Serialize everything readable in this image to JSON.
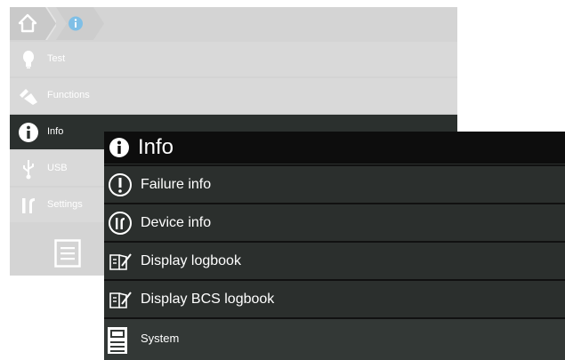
{
  "background_menu": {
    "items": [
      {
        "label": "Test",
        "icon": "lightbulb-icon"
      },
      {
        "label": "Functions",
        "icon": "tools-icon"
      },
      {
        "label": "Info",
        "icon": "info-icon"
      },
      {
        "label": "USB",
        "icon": "usb-icon"
      },
      {
        "label": "Settings",
        "icon": "wrench-icon"
      }
    ],
    "active_item": "Info",
    "footer_icon": "menu-list-icon"
  },
  "breadcrumb": {
    "items": [
      "home-icon",
      "info-icon"
    ]
  },
  "info_panel": {
    "title": "Info",
    "items": [
      {
        "label": "Failure info",
        "icon": "exclamation-circle-icon"
      },
      {
        "label": "Device info",
        "icon": "device-tools-circle-icon"
      },
      {
        "label": "Display logbook",
        "icon": "logbook-icon"
      },
      {
        "label": "Display BCS logbook",
        "icon": "logbook-icon"
      },
      {
        "label": "System",
        "icon": "system-device-icon"
      }
    ]
  },
  "colors": {
    "panel_bg": "#2b2f2d",
    "header_bg": "#0d0d0d",
    "dimmed_bg": "#d4d4d4",
    "breadcrumb_accent": "#7fbfe6"
  }
}
